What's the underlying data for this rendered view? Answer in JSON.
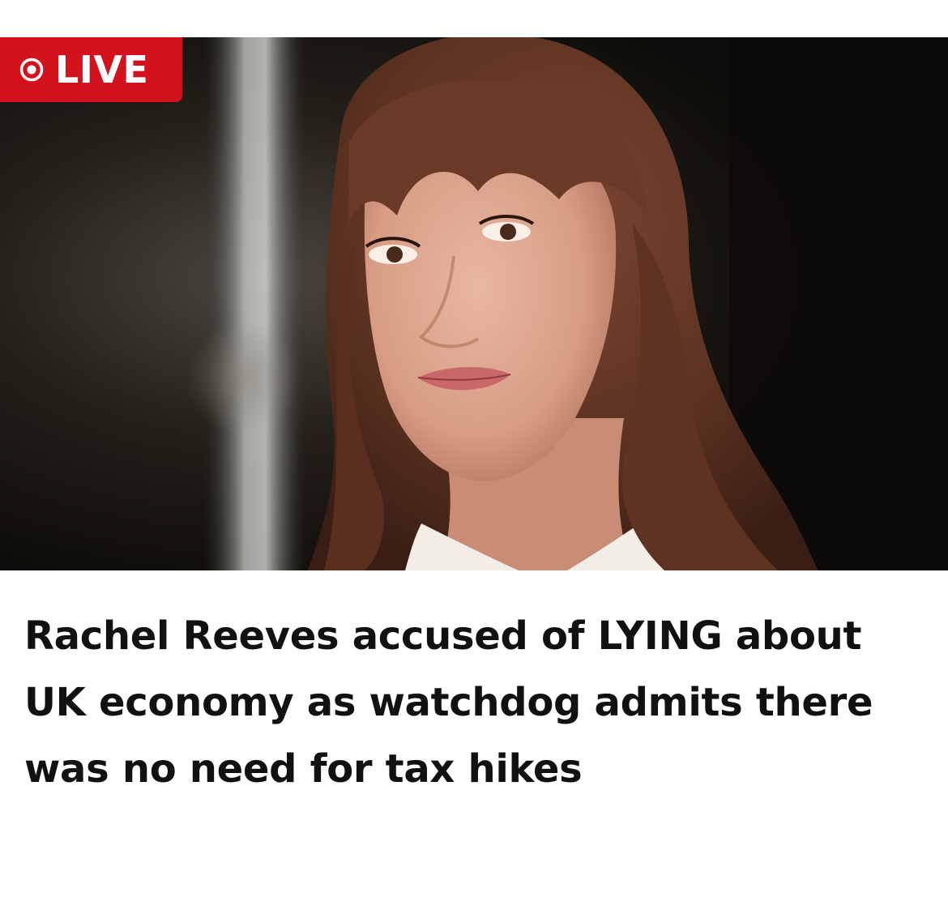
{
  "badge": {
    "label": "LIVE",
    "icon": "live-record-icon",
    "color": "#d3121d"
  },
  "hero_image": {
    "alt": "Photo of Rachel Reeves"
  },
  "article": {
    "headline": "Rachel Reeves accused of LYING about UK economy as watchdog admits there was no need for tax hikes"
  }
}
